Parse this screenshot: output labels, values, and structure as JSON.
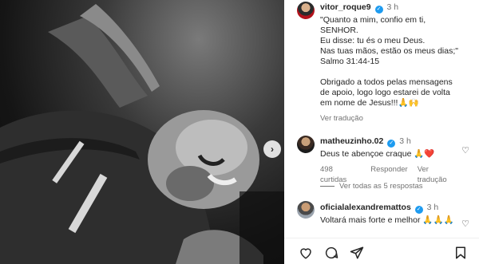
{
  "post": {
    "next_icon": "chevron-right-icon"
  },
  "caption": {
    "username": "vitor_roque9",
    "time": "3 h",
    "text": "\"Quanto a mim, confio em ti, SENHOR.\nEu disse: tu és o meu Deus.\nNas tuas mãos, estão os meus dias;\"\nSalmo 31:44-15\n\nObrigado a todos pelas mensagens de apoio, logo logo estarei de volta em nome de Jesus!!!🙏🙌",
    "translate": "Ver tradução"
  },
  "comments": [
    {
      "username": "matheuzinho.02",
      "time": "3 h",
      "text": "Deus te abençoe craque 🙏❤️",
      "likes": "498 curtidas",
      "reply": "Responder",
      "translate": "Ver tradução"
    },
    {
      "username": "oficialalexandremattos",
      "time": "3 h",
      "text": "Voltará mais forte e melhor 🙏🙏🙏"
    }
  ],
  "replies": {
    "label": "Ver todas as 5 respostas"
  },
  "actions": [
    "heart-icon",
    "comment-icon",
    "share-icon",
    "bookmark-icon"
  ]
}
